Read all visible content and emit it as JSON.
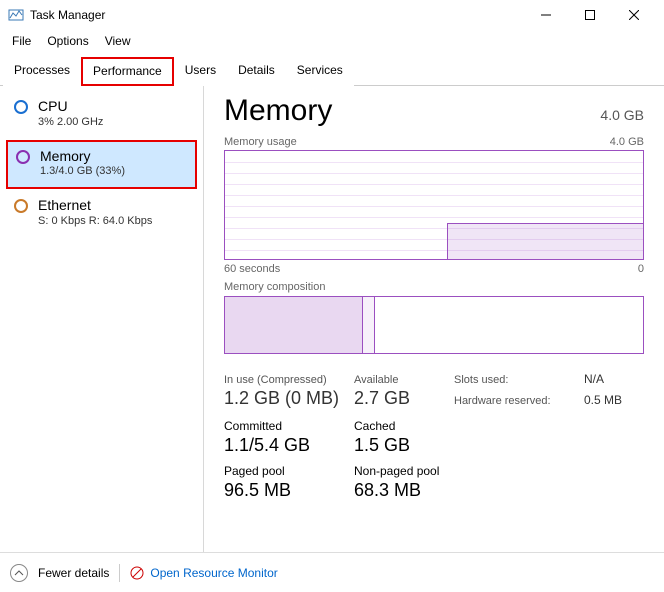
{
  "window": {
    "title": "Task Manager"
  },
  "menu": {
    "file": "File",
    "options": "Options",
    "view": "View"
  },
  "tabs": {
    "processes": "Processes",
    "performance": "Performance",
    "users": "Users",
    "details": "Details",
    "services": "Services",
    "active": "performance"
  },
  "sidebar": {
    "cpu": {
      "label": "CPU",
      "sub": "3% 2.00 GHz"
    },
    "memory": {
      "label": "Memory",
      "sub": "1.3/4.0 GB (33%)"
    },
    "ethernet": {
      "label": "Ethernet",
      "sub": "S: 0 Kbps R: 64.0 Kbps"
    },
    "selected": "memory"
  },
  "main": {
    "title": "Memory",
    "capacity": "4.0 GB",
    "usage_label": "Memory usage",
    "usage_max": "4.0 GB",
    "xaxis_left": "60 seconds",
    "xaxis_right": "0",
    "composition_label": "Memory composition",
    "stats": {
      "in_use_label": "In use (Compressed)",
      "in_use_value": "1.2 GB (0 MB)",
      "available_label": "Available",
      "available_value": "2.7 GB",
      "slots_label": "Slots used:",
      "slots_value": "N/A",
      "hw_label": "Hardware reserved:",
      "hw_value": "0.5 MB",
      "committed_label": "Committed",
      "committed_value": "1.1/5.4 GB",
      "cached_label": "Cached",
      "cached_value": "1.5 GB",
      "paged_label": "Paged pool",
      "paged_value": "96.5 MB",
      "nonpaged_label": "Non-paged pool",
      "nonpaged_value": "68.3 MB"
    }
  },
  "footer": {
    "fewer_details": "Fewer details",
    "open_monitor": "Open Resource Monitor"
  },
  "chart_data": {
    "type": "line",
    "title": "Memory usage",
    "ylabel": "GB",
    "ylim": [
      0,
      4.0
    ],
    "x": [
      60,
      55,
      50,
      45,
      40,
      35,
      30,
      25,
      20,
      15,
      10,
      5,
      0
    ],
    "series": [
      {
        "name": "Memory usage (GB)",
        "values": [
          null,
          null,
          null,
          null,
          null,
          null,
          null,
          1.2,
          1.3,
          1.3,
          1.3,
          1.3,
          1.3
        ]
      }
    ],
    "composition": {
      "in_use_pct": 33,
      "modified_pct": 3,
      "standby_free_pct": 64
    }
  }
}
